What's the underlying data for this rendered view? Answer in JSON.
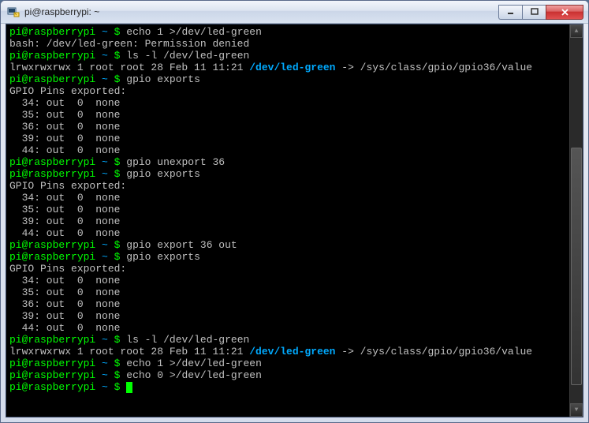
{
  "window": {
    "title": "pi@raspberrypi: ~"
  },
  "prompt": {
    "user": "pi@raspberrypi",
    "sep": " ~ $ ",
    "tilde": "~",
    "dollar": "$"
  },
  "lines": [
    {
      "t": "prompt",
      "cmd": "echo 1 >/dev/led-green"
    },
    {
      "t": "out",
      "text": "bash: /dev/led-green: Permission denied"
    },
    {
      "t": "prompt",
      "cmd": "ls -l /dev/led-green"
    },
    {
      "t": "ls",
      "perm": "lrwxrwxrwx 1 root root 28 Feb 11 11:21 ",
      "link": "/dev/led-green",
      "arrow": " -> /sys/class/gpio/gpio36/value"
    },
    {
      "t": "prompt",
      "cmd": "gpio exports"
    },
    {
      "t": "out",
      "text": "GPIO Pins exported:"
    },
    {
      "t": "out",
      "text": "  34: out  0  none"
    },
    {
      "t": "out",
      "text": "  35: out  0  none"
    },
    {
      "t": "out",
      "text": "  36: out  0  none"
    },
    {
      "t": "out",
      "text": "  39: out  0  none"
    },
    {
      "t": "out",
      "text": "  44: out  0  none"
    },
    {
      "t": "prompt",
      "cmd": "gpio unexport 36"
    },
    {
      "t": "prompt",
      "cmd": "gpio exports"
    },
    {
      "t": "out",
      "text": "GPIO Pins exported:"
    },
    {
      "t": "out",
      "text": "  34: out  0  none"
    },
    {
      "t": "out",
      "text": "  35: out  0  none"
    },
    {
      "t": "out",
      "text": "  39: out  0  none"
    },
    {
      "t": "out",
      "text": "  44: out  0  none"
    },
    {
      "t": "prompt",
      "cmd": "gpio export 36 out"
    },
    {
      "t": "prompt",
      "cmd": "gpio exports"
    },
    {
      "t": "out",
      "text": "GPIO Pins exported:"
    },
    {
      "t": "out",
      "text": "  34: out  0  none"
    },
    {
      "t": "out",
      "text": "  35: out  0  none"
    },
    {
      "t": "out",
      "text": "  36: out  0  none"
    },
    {
      "t": "out",
      "text": "  39: out  0  none"
    },
    {
      "t": "out",
      "text": "  44: out  0  none"
    },
    {
      "t": "prompt",
      "cmd": "ls -l /dev/led-green"
    },
    {
      "t": "ls",
      "perm": "lrwxrwxrwx 1 root root 28 Feb 11 11:21 ",
      "link": "/dev/led-green",
      "arrow": " -> /sys/class/gpio/gpio36/value"
    },
    {
      "t": "prompt",
      "cmd": "echo 1 >/dev/led-green"
    },
    {
      "t": "prompt",
      "cmd": "echo 0 >/dev/led-green"
    },
    {
      "t": "prompt-cursor",
      "cmd": ""
    }
  ]
}
